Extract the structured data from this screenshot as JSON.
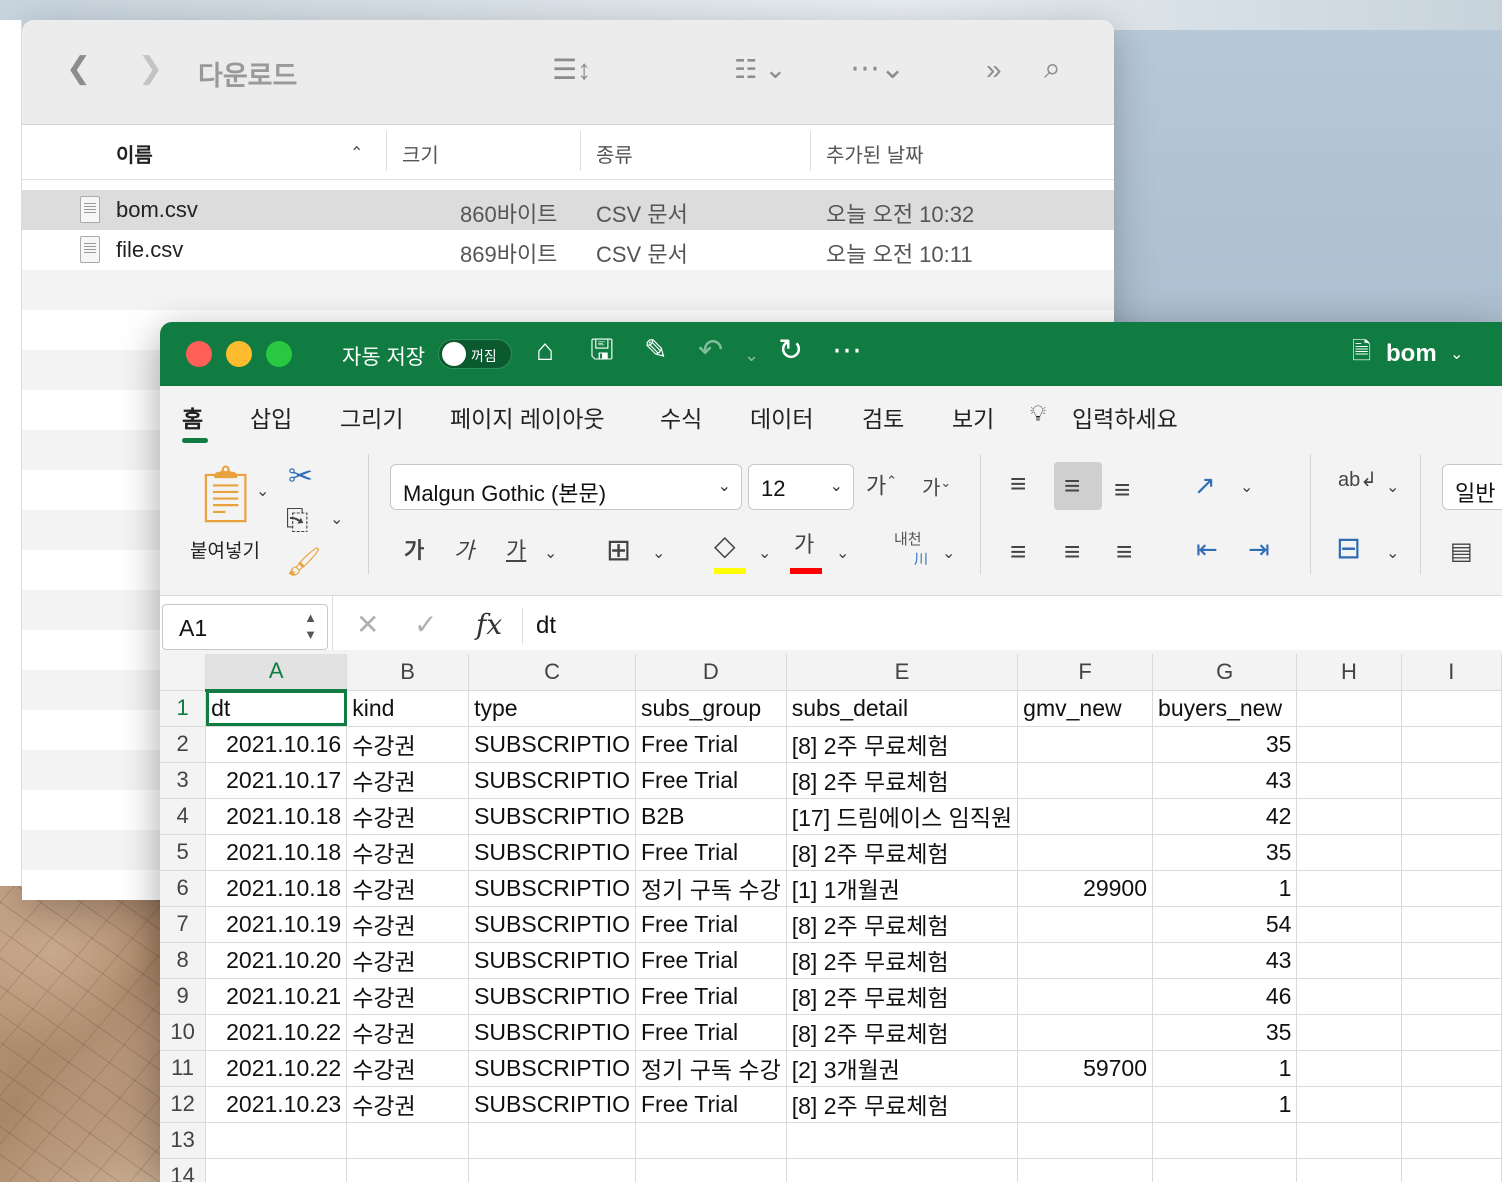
{
  "finder": {
    "title": "다운로드",
    "columns": {
      "name": "이름",
      "size": "크기",
      "kind": "종류",
      "date_added": "추가된 날짜"
    },
    "files": [
      {
        "name": "bom.csv",
        "size": "860바이트",
        "kind": "CSV 문서",
        "date": "오늘 오전 10:32"
      },
      {
        "name": "file.csv",
        "size": "869바이트",
        "kind": "CSV 문서",
        "date": "오늘 오전 10:11"
      }
    ]
  },
  "excel": {
    "autosave_label": "자동 저장",
    "toggle_label": "꺼짐",
    "doc_title": "bom",
    "tabs": [
      "홈",
      "삽입",
      "그리기",
      "페이지 레이아웃",
      "수식",
      "데이터",
      "검토",
      "보기",
      "입력하세요"
    ],
    "paste_label": "붙여넣기",
    "font_name": "Malgun Gothic (본문)",
    "font_size": "12",
    "bold_glyph": "가",
    "italic_glyph": "가",
    "underline_glyph": "가",
    "font_color_glyph": "가",
    "grow_font_glyph": "가",
    "shrink_font_glyph": "가",
    "phonetic_label": "내천",
    "number_format": "일반",
    "name_box": "A1",
    "formula_value": "dt",
    "col_headers": [
      "A",
      "B",
      "C",
      "D",
      "E",
      "F",
      "G",
      "H",
      "I"
    ],
    "row_numbers": [
      "1",
      "2",
      "3",
      "4",
      "5",
      "6",
      "7",
      "8",
      "9",
      "10",
      "11",
      "12",
      "13",
      "14"
    ],
    "header_row": [
      "dt",
      "kind",
      "type",
      "subs_group",
      "subs_detail",
      "gmv_new",
      "buyers_new"
    ],
    "rows": [
      [
        "2021.10.16",
        "수강권",
        "SUBSCRIPTIO",
        "Free Trial",
        "[8] 2주 무료체험",
        "",
        "35"
      ],
      [
        "2021.10.17",
        "수강권",
        "SUBSCRIPTIO",
        "Free Trial",
        "[8] 2주 무료체험",
        "",
        "43"
      ],
      [
        "2021.10.18",
        "수강권",
        "SUBSCRIPTIO",
        "B2B",
        "[17] 드림에이스 임직원",
        "",
        "42"
      ],
      [
        "2021.10.18",
        "수강권",
        "SUBSCRIPTIO",
        "Free Trial",
        "[8] 2주 무료체험",
        "",
        "35"
      ],
      [
        "2021.10.18",
        "수강권",
        "SUBSCRIPTIO",
        "정기 구독 수강",
        "[1] 1개월권",
        "29900",
        "1"
      ],
      [
        "2021.10.19",
        "수강권",
        "SUBSCRIPTIO",
        "Free Trial",
        "[8] 2주 무료체험",
        "",
        "54"
      ],
      [
        "2021.10.20",
        "수강권",
        "SUBSCRIPTIO",
        "Free Trial",
        "[8] 2주 무료체험",
        "",
        "43"
      ],
      [
        "2021.10.21",
        "수강권",
        "SUBSCRIPTIO",
        "Free Trial",
        "[8] 2주 무료체험",
        "",
        "46"
      ],
      [
        "2021.10.22",
        "수강권",
        "SUBSCRIPTIO",
        "Free Trial",
        "[8] 2주 무료체험",
        "",
        "35"
      ],
      [
        "2021.10.22",
        "수강권",
        "SUBSCRIPTIO",
        "정기 구독 수강",
        "[2] 3개월권",
        "59700",
        "1"
      ],
      [
        "2021.10.23",
        "수강권",
        "SUBSCRIPTIO",
        "Free Trial",
        "[8] 2주 무료체험",
        "",
        "1"
      ]
    ],
    "colors": {
      "brand": "#107c41",
      "highlight": "#ffff00",
      "font_color": "#ff0000"
    }
  }
}
